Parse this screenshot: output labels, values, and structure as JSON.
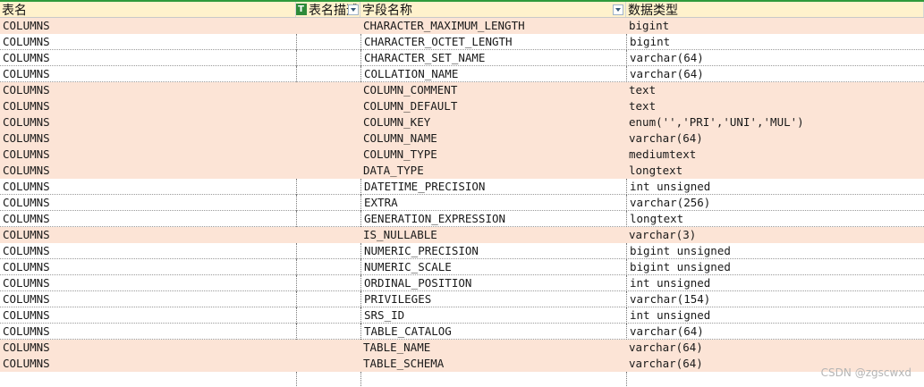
{
  "header": {
    "columns": [
      {
        "label": "表名"
      },
      {
        "label": "表名描述"
      },
      {
        "label": "字段名称"
      },
      {
        "label": "数据类型"
      }
    ]
  },
  "rows": [
    {
      "table": "COLUMNS",
      "desc": "",
      "field": "CHARACTER_MAXIMUM_LENGTH",
      "type": "bigint",
      "highlight": true
    },
    {
      "table": "COLUMNS",
      "desc": "",
      "field": "CHARACTER_OCTET_LENGTH",
      "type": "bigint",
      "highlight": false
    },
    {
      "table": "COLUMNS",
      "desc": "",
      "field": "CHARACTER_SET_NAME",
      "type": "varchar(64)",
      "highlight": false
    },
    {
      "table": "COLUMNS",
      "desc": "",
      "field": "COLLATION_NAME",
      "type": "varchar(64)",
      "highlight": false
    },
    {
      "table": "COLUMNS",
      "desc": "",
      "field": "COLUMN_COMMENT",
      "type": "text",
      "highlight": true
    },
    {
      "table": "COLUMNS",
      "desc": "",
      "field": "COLUMN_DEFAULT",
      "type": "text",
      "highlight": true
    },
    {
      "table": "COLUMNS",
      "desc": "",
      "field": "COLUMN_KEY",
      "type": "enum('','PRI','UNI','MUL')",
      "highlight": true
    },
    {
      "table": "COLUMNS",
      "desc": "",
      "field": "COLUMN_NAME",
      "type": "varchar(64)",
      "highlight": true
    },
    {
      "table": "COLUMNS",
      "desc": "",
      "field": "COLUMN_TYPE",
      "type": "mediumtext",
      "highlight": true
    },
    {
      "table": "COLUMNS",
      "desc": "",
      "field": "DATA_TYPE",
      "type": "longtext",
      "highlight": true
    },
    {
      "table": "COLUMNS",
      "desc": "",
      "field": "DATETIME_PRECISION",
      "type": "int unsigned",
      "highlight": false
    },
    {
      "table": "COLUMNS",
      "desc": "",
      "field": "EXTRA",
      "type": "varchar(256)",
      "highlight": false
    },
    {
      "table": "COLUMNS",
      "desc": "",
      "field": "GENERATION_EXPRESSION",
      "type": "longtext",
      "highlight": false
    },
    {
      "table": "COLUMNS",
      "desc": "",
      "field": "IS_NULLABLE",
      "type": "varchar(3)",
      "highlight": true
    },
    {
      "table": "COLUMNS",
      "desc": "",
      "field": "NUMERIC_PRECISION",
      "type": "bigint unsigned",
      "highlight": false
    },
    {
      "table": "COLUMNS",
      "desc": "",
      "field": "NUMERIC_SCALE",
      "type": "bigint unsigned",
      "highlight": false
    },
    {
      "table": "COLUMNS",
      "desc": "",
      "field": "ORDINAL_POSITION",
      "type": "int unsigned",
      "highlight": false
    },
    {
      "table": "COLUMNS",
      "desc": "",
      "field": "PRIVILEGES",
      "type": "varchar(154)",
      "highlight": false
    },
    {
      "table": "COLUMNS",
      "desc": "",
      "field": "SRS_ID",
      "type": "int unsigned",
      "highlight": false
    },
    {
      "table": "COLUMNS",
      "desc": "",
      "field": "TABLE_CATALOG",
      "type": "varchar(64)",
      "highlight": false
    },
    {
      "table": "COLUMNS",
      "desc": "",
      "field": "TABLE_NAME",
      "type": "varchar(64)",
      "highlight": true
    },
    {
      "table": "COLUMNS",
      "desc": "",
      "field": "TABLE_SCHEMA",
      "type": "varchar(64)",
      "highlight": true
    }
  ],
  "colors": {
    "header_bg": "#fff2cc",
    "highlight_row": "#fce4d6",
    "accent_green": "#2f9a3b"
  },
  "icons": {
    "header_b_icon": "text-filter-icon",
    "filter": "dropdown-filter-icon"
  },
  "watermark": "CSDN @zgscwxd"
}
